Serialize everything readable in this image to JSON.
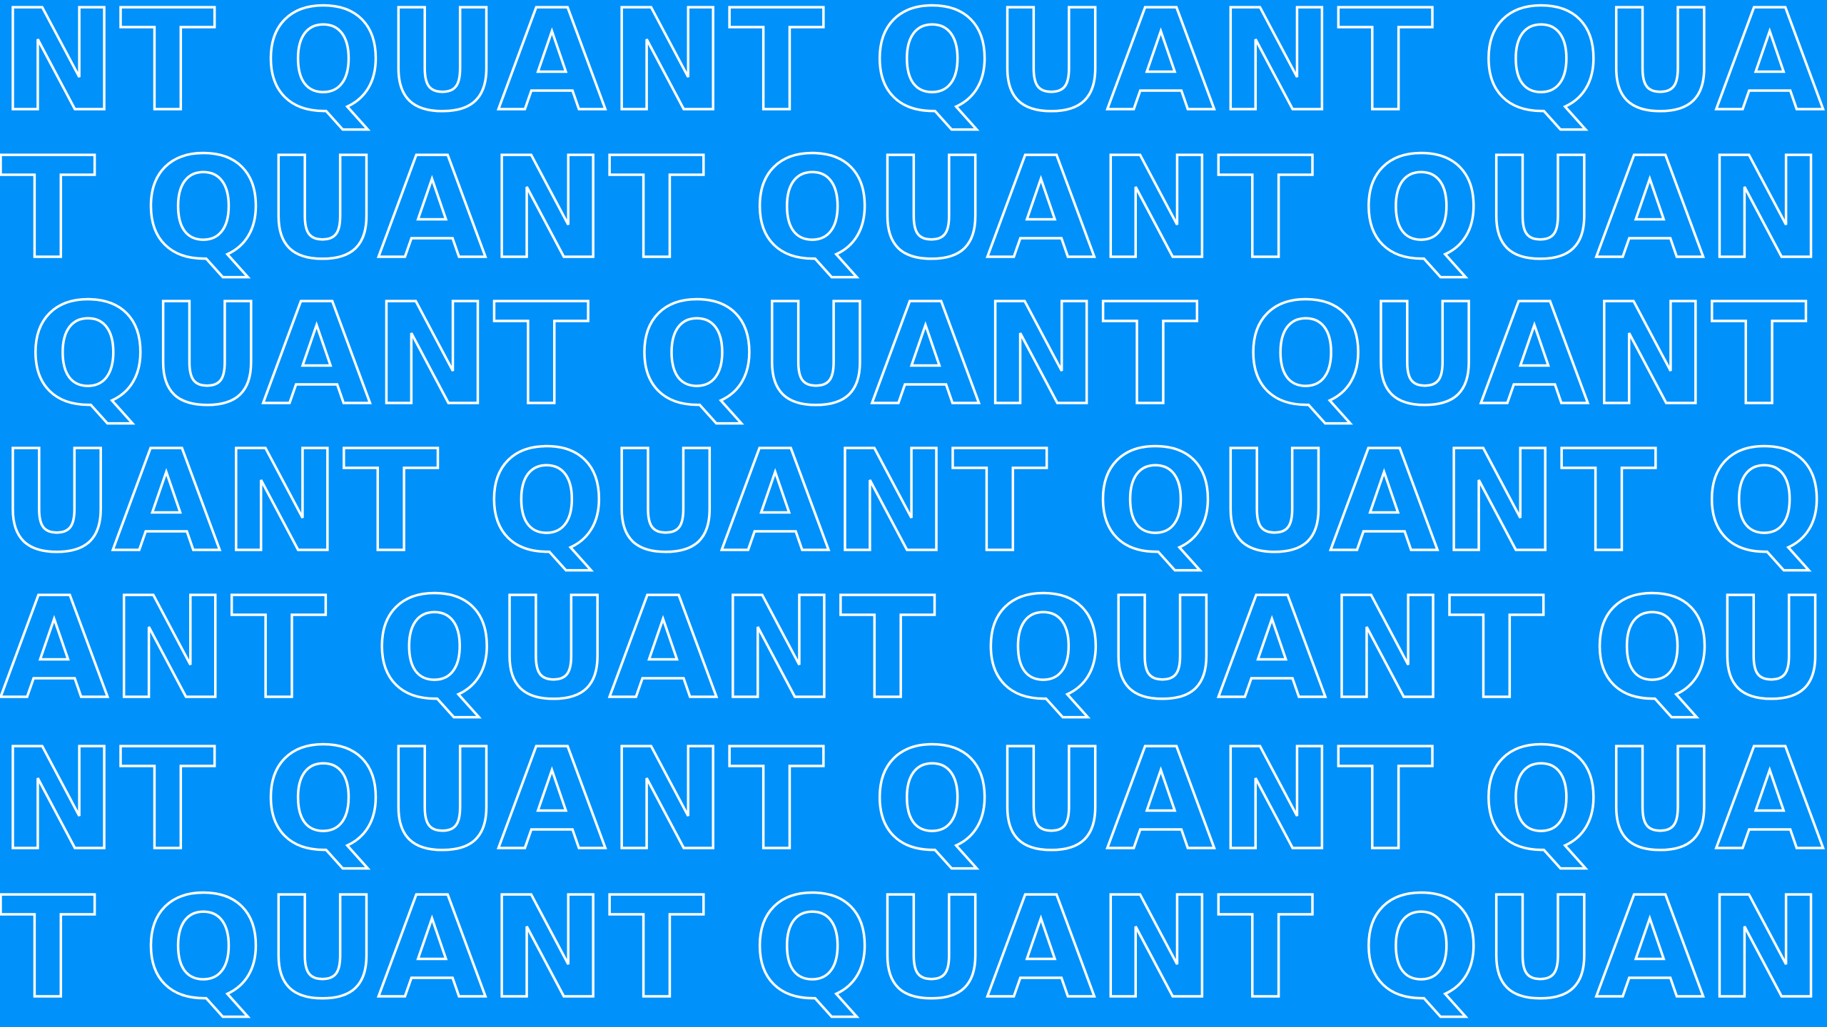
{
  "background_color": "#0091FB",
  "outline_color": "#FFFFFF",
  "pattern": {
    "word": "QUANT",
    "rows": [
      {
        "words": [
          "NT",
          "QUANT",
          "QUANT",
          "QUA"
        ]
      },
      {
        "words": [
          "T",
          "QUANT",
          "QUANT",
          "QUAN"
        ]
      },
      {
        "words": [
          "QUANT",
          "QUANT",
          "QUANT"
        ]
      },
      {
        "words": [
          "UANT",
          "QUANT",
          "QUANT",
          "Q"
        ]
      },
      {
        "words": [
          "ANT",
          "QUANT",
          "QUANT",
          "QU"
        ]
      },
      {
        "words": [
          "NT",
          "QUANT",
          "QUANT",
          "QUA"
        ]
      },
      {
        "words": [
          "T",
          "QUANT",
          "QUANT",
          "QUAN"
        ]
      }
    ]
  }
}
